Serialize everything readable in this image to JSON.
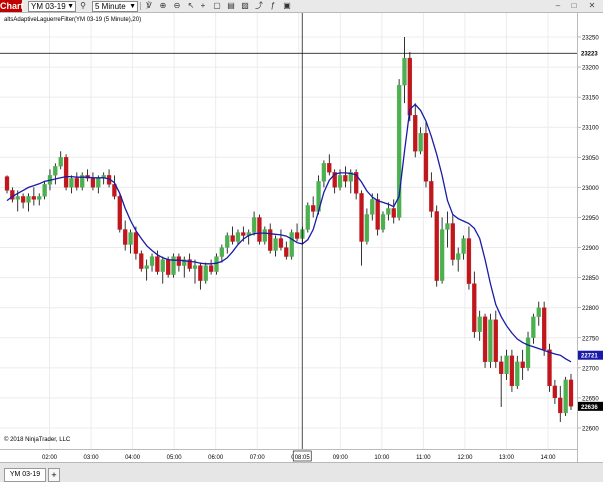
{
  "toolbar": {
    "chart_tag": "Chart",
    "instrument": "YM 03-19",
    "interval": "5 Minute",
    "icons": [
      "search-icon",
      "bar-style-icon",
      "zoom-in-icon",
      "zoom-out-icon",
      "pointer-icon",
      "crosshair-icon",
      "data-box-icon",
      "properties-icon",
      "strategies-icon",
      "drawing-tools-icon",
      "indicators-icon",
      "snapshot-icon"
    ]
  },
  "window_controls": {
    "minimize": "–",
    "maximize": "□",
    "close": "✕"
  },
  "indicator_label": "altsAdaptiveLaguerreFilter(YM 03-19 (5 Minute),20)",
  "copyright": "© 2018 NinjaTrader, LLC",
  "crosshair_time": "08:05",
  "price_axis": {
    "ticks": [
      "23250",
      "23200",
      "23150",
      "23100",
      "23050",
      "23000",
      "22950",
      "22900",
      "22850",
      "22800",
      "22750",
      "22700",
      "22650",
      "22600"
    ],
    "crosshair_price": "23223",
    "filter_price": "22721",
    "last_price": "22636"
  },
  "time_axis": {
    "ticks": [
      "02:00",
      "03:00",
      "04:00",
      "05:00",
      "06:00",
      "07:00",
      "08:00",
      "09:00",
      "10:00",
      "11:00",
      "12:00",
      "13:00",
      "14:00"
    ]
  },
  "tab": {
    "label": "YM 03-19",
    "add": "+"
  },
  "colors": {
    "up": "#4cb050",
    "down": "#c0171d",
    "filter": "#1a1aa8",
    "grid": "#ececec",
    "crosshair": "#000000"
  },
  "chart_data": {
    "type": "candlestick",
    "series": [
      {
        "name": "YM 03-19",
        "kind": "ohlc",
        "points": [
          [
            23018,
            23020,
            22990,
            22995
          ],
          [
            22995,
            23000,
            22975,
            22980
          ],
          [
            22980,
            22995,
            22960,
            22985
          ],
          [
            22985,
            22990,
            22965,
            22975
          ],
          [
            22975,
            22990,
            22960,
            22985
          ],
          [
            22985,
            23000,
            22970,
            22980
          ],
          [
            22980,
            22990,
            22970,
            22985
          ],
          [
            22985,
            23010,
            22980,
            23005
          ],
          [
            23005,
            23030,
            22995,
            23020
          ],
          [
            23020,
            23040,
            23005,
            23035
          ],
          [
            23035,
            23060,
            23030,
            23050
          ],
          [
            23050,
            23055,
            22995,
            23000
          ],
          [
            23000,
            23020,
            22990,
            23015
          ],
          [
            23015,
            23025,
            22995,
            23000
          ],
          [
            23000,
            23025,
            22995,
            23020
          ],
          [
            23020,
            23030,
            23010,
            23015
          ],
          [
            23015,
            23025,
            22995,
            23000
          ],
          [
            23000,
            23020,
            22990,
            23015
          ],
          [
            23015,
            23025,
            23005,
            23020
          ],
          [
            23020,
            23030,
            23000,
            23005
          ],
          [
            23005,
            23020,
            22980,
            22985
          ],
          [
            22985,
            22990,
            22925,
            22930
          ],
          [
            22930,
            22945,
            22895,
            22905
          ],
          [
            22905,
            22930,
            22890,
            22925
          ],
          [
            22925,
            22935,
            22880,
            22890
          ],
          [
            22890,
            22895,
            22860,
            22865
          ],
          [
            22865,
            22880,
            22845,
            22870
          ],
          [
            22870,
            22890,
            22860,
            22885
          ],
          [
            22885,
            22895,
            22855,
            22860
          ],
          [
            22860,
            22885,
            22840,
            22880
          ],
          [
            22880,
            22885,
            22850,
            22855
          ],
          [
            22855,
            22890,
            22850,
            22885
          ],
          [
            22885,
            22890,
            22860,
            22870
          ],
          [
            22870,
            22885,
            22850,
            22880
          ],
          [
            22880,
            22890,
            22860,
            22865
          ],
          [
            22865,
            22880,
            22840,
            22870
          ],
          [
            22870,
            22875,
            22830,
            22845
          ],
          [
            22845,
            22875,
            22840,
            22870
          ],
          [
            22870,
            22880,
            22855,
            22860
          ],
          [
            22860,
            22890,
            22855,
            22885
          ],
          [
            22885,
            22905,
            22875,
            22900
          ],
          [
            22900,
            22925,
            22890,
            22920
          ],
          [
            22920,
            22935,
            22905,
            22910
          ],
          [
            22910,
            22930,
            22905,
            22925
          ],
          [
            22925,
            22935,
            22910,
            22920
          ],
          [
            22920,
            22930,
            22905,
            22925
          ],
          [
            22925,
            22960,
            22920,
            22950
          ],
          [
            22950,
            22955,
            22905,
            22910
          ],
          [
            22910,
            22935,
            22905,
            22930
          ],
          [
            22930,
            22940,
            22890,
            22895
          ],
          [
            22895,
            22920,
            22885,
            22915
          ],
          [
            22915,
            22930,
            22895,
            22900
          ],
          [
            22900,
            22910,
            22880,
            22885
          ],
          [
            22885,
            22930,
            22880,
            22925
          ],
          [
            22925,
            22940,
            22910,
            22915
          ],
          [
            22915,
            22935,
            22905,
            22930
          ],
          [
            22930,
            22975,
            22925,
            22970
          ],
          [
            22970,
            22985,
            22950,
            22960
          ],
          [
            22960,
            23020,
            22955,
            23010
          ],
          [
            23010,
            23045,
            23000,
            23040
          ],
          [
            23040,
            23055,
            23020,
            23025
          ],
          [
            23025,
            23030,
            22990,
            23000
          ],
          [
            23000,
            23030,
            22995,
            23020
          ],
          [
            23020,
            23035,
            23000,
            23010
          ],
          [
            23010,
            23030,
            22990,
            23025
          ],
          [
            23025,
            23030,
            22980,
            22990
          ],
          [
            22990,
            22995,
            22870,
            22910
          ],
          [
            22910,
            22965,
            22905,
            22955
          ],
          [
            22955,
            22990,
            22945,
            22980
          ],
          [
            22980,
            22990,
            22920,
            22930
          ],
          [
            22930,
            22960,
            22925,
            22955
          ],
          [
            22955,
            22975,
            22945,
            22965
          ],
          [
            22965,
            22980,
            22940,
            22950
          ],
          [
            22950,
            23180,
            22945,
            23170
          ],
          [
            23170,
            23250,
            23140,
            23215
          ],
          [
            23215,
            23225,
            23110,
            23120
          ],
          [
            23120,
            23140,
            23050,
            23060
          ],
          [
            23060,
            23100,
            23055,
            23090
          ],
          [
            23090,
            23110,
            23000,
            23010
          ],
          [
            23010,
            23025,
            22950,
            22960
          ],
          [
            22960,
            22970,
            22835,
            22845
          ],
          [
            22845,
            22950,
            22840,
            22930
          ],
          [
            22930,
            22960,
            22900,
            22940
          ],
          [
            22940,
            22955,
            22870,
            22880
          ],
          [
            22880,
            22900,
            22860,
            22890
          ],
          [
            22890,
            22920,
            22880,
            22915
          ],
          [
            22915,
            22935,
            22830,
            22840
          ],
          [
            22840,
            22860,
            22750,
            22760
          ],
          [
            22760,
            22795,
            22745,
            22785
          ],
          [
            22785,
            22790,
            22700,
            22710
          ],
          [
            22710,
            22790,
            22700,
            22780
          ],
          [
            22780,
            22795,
            22700,
            22710
          ],
          [
            22710,
            22720,
            22635,
            22690
          ],
          [
            22690,
            22730,
            22680,
            22720
          ],
          [
            22720,
            22730,
            22660,
            22670
          ],
          [
            22670,
            22720,
            22665,
            22710
          ],
          [
            22710,
            22730,
            22680,
            22700
          ],
          [
            22700,
            22760,
            22695,
            22750
          ],
          [
            22750,
            22790,
            22740,
            22785
          ],
          [
            22785,
            22810,
            22770,
            22800
          ],
          [
            22800,
            22810,
            22720,
            22730
          ],
          [
            22730,
            22740,
            22660,
            22670
          ],
          [
            22670,
            22680,
            22640,
            22650
          ],
          [
            22650,
            22670,
            22610,
            22625
          ],
          [
            22625,
            22685,
            22620,
            22680
          ],
          [
            22680,
            22690,
            22630,
            22636
          ]
        ]
      },
      {
        "name": "altsAdaptiveLaguerreFilter",
        "kind": "line",
        "values": [
          22978,
          22985,
          22990,
          22995,
          23000,
          23003,
          23006,
          23010,
          23012,
          23014,
          23016,
          23018,
          23018,
          23017,
          23017,
          23017,
          23016,
          23016,
          23016,
          23014,
          23008,
          22990,
          22965,
          22945,
          22928,
          22915,
          22903,
          22895,
          22888,
          22883,
          22880,
          22879,
          22879,
          22878,
          22877,
          22876,
          22874,
          22873,
          22873,
          22874,
          22877,
          22883,
          22893,
          22905,
          22914,
          22920,
          22923,
          22924,
          22924,
          22923,
          22922,
          22921,
          22919,
          22914,
          22908,
          22906,
          22913,
          22930,
          22960,
          22992,
          23012,
          23022,
          23024,
          23024,
          23023,
          23021,
          23009,
          22994,
          22984,
          22978,
          22975,
          22972,
          22968,
          22985,
          23060,
          23130,
          23138,
          23128,
          23110,
          23085,
          23055,
          23020,
          22978,
          22955,
          22948,
          22944,
          22940,
          22932,
          22915,
          22880,
          22840,
          22805,
          22785,
          22770,
          22758,
          22748,
          22742,
          22738,
          22735,
          22732,
          22729,
          22726,
          22723,
          22721,
          22715,
          22710
        ]
      }
    ]
  }
}
